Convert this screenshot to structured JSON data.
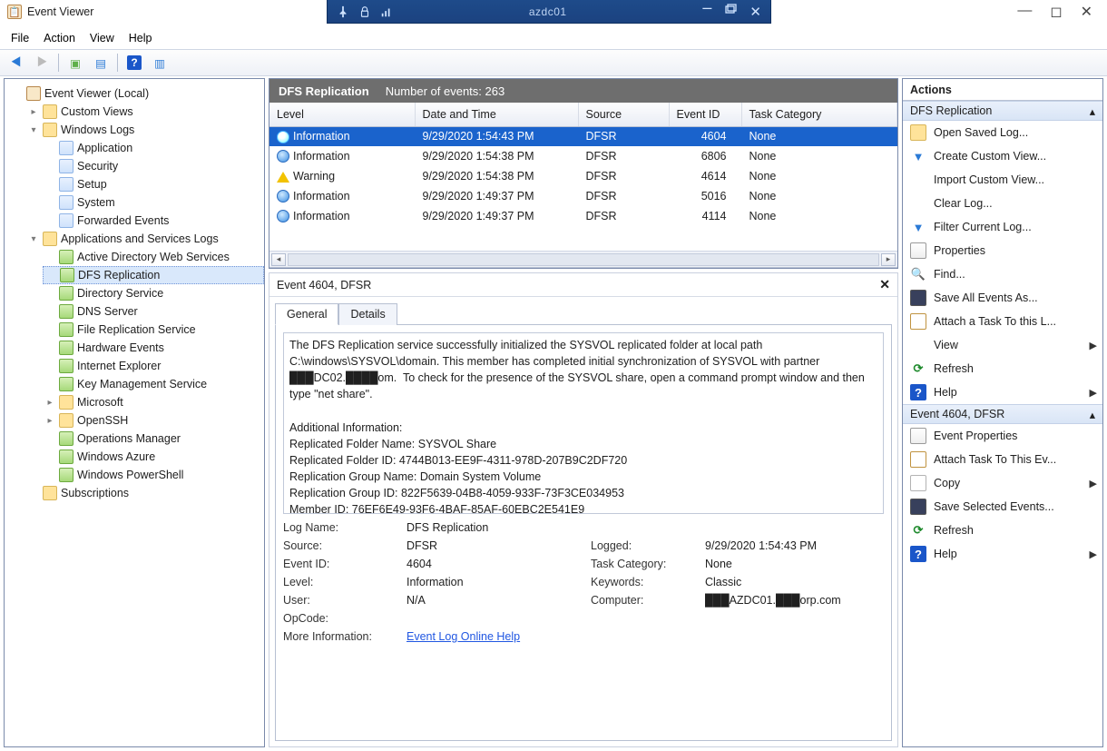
{
  "rd": {
    "host": "azdc01"
  },
  "window": {
    "title": "Event Viewer"
  },
  "menu": {
    "file": "File",
    "action": "Action",
    "view": "View",
    "help": "Help"
  },
  "tree": {
    "root": "Event Viewer (Local)",
    "custom": "Custom Views",
    "winlogs": "Windows Logs",
    "winlogs_items": [
      "Application",
      "Security",
      "Setup",
      "System",
      "Forwarded Events"
    ],
    "appsvc": "Applications and Services Logs",
    "appsvc_items": [
      "Active Directory Web Services",
      "DFS Replication",
      "Directory Service",
      "DNS Server",
      "File Replication Service",
      "Hardware Events",
      "Internet Explorer",
      "Key Management Service",
      "Microsoft",
      "OpenSSH",
      "Operations Manager",
      "Windows Azure",
      "Windows PowerShell"
    ],
    "subs": "Subscriptions"
  },
  "center": {
    "title": "DFS Replication",
    "events_count_label": "Number of events: 263",
    "columns": [
      "Level",
      "Date and Time",
      "Source",
      "Event ID",
      "Task Category"
    ],
    "rows": [
      {
        "level": "Information",
        "icon": "info",
        "datetime": "9/29/2020 1:54:43 PM",
        "source": "DFSR",
        "event_id": "4604",
        "task": "None",
        "selected": true
      },
      {
        "level": "Information",
        "icon": "info",
        "datetime": "9/29/2020 1:54:38 PM",
        "source": "DFSR",
        "event_id": "6806",
        "task": "None"
      },
      {
        "level": "Warning",
        "icon": "warn",
        "datetime": "9/29/2020 1:54:38 PM",
        "source": "DFSR",
        "event_id": "4614",
        "task": "None"
      },
      {
        "level": "Information",
        "icon": "info",
        "datetime": "9/29/2020 1:49:37 PM",
        "source": "DFSR",
        "event_id": "5016",
        "task": "None"
      },
      {
        "level": "Information",
        "icon": "info",
        "datetime": "9/29/2020 1:49:37 PM",
        "source": "DFSR",
        "event_id": "4114",
        "task": "None"
      }
    ]
  },
  "detail": {
    "header": "Event 4604, DFSR",
    "tab_general": "General",
    "tab_details": "Details",
    "message": "The DFS Replication service successfully initialized the SYSVOL replicated folder at local path C:\\windows\\SYSVOL\\domain. This member has completed initial synchronization of SYSVOL with partner ███DC02.████om.  To check for the presence of the SYSVOL share, open a command prompt window and then type \"net share\".\n\nAdditional Information:\nReplicated Folder Name: SYSVOL Share\nReplicated Folder ID: 4744B013-EE9F-4311-978D-207B9C2DF720\nReplication Group Name: Domain System Volume\nReplication Group ID: 822F5639-04B8-4059-933F-73F3CE034953\nMember ID: 76EF6E49-93F6-4BAF-85AF-60EBC2E541E9",
    "labels": {
      "log_name": "Log Name:",
      "source": "Source:",
      "event_id": "Event ID:",
      "level": "Level:",
      "user": "User:",
      "opcode": "OpCode:",
      "more_info": "More Information:",
      "logged": "Logged:",
      "task_cat": "Task Category:",
      "keywords": "Keywords:",
      "computer": "Computer:"
    },
    "values": {
      "log_name": "DFS Replication",
      "source": "DFSR",
      "event_id": "4604",
      "level": "Information",
      "user": "N/A",
      "opcode": "",
      "logged": "9/29/2020 1:54:43 PM",
      "task_cat": "None",
      "keywords": "Classic",
      "computer": "███AZDC01.███orp.com",
      "more_info_link": "Event Log Online Help"
    }
  },
  "actions": {
    "title": "Actions",
    "section1": "DFS Replication",
    "section2": "Event 4604, DFSR",
    "view_label": "View",
    "refresh_label": "Refresh",
    "help_label": "Help",
    "items1": [
      "Open Saved Log...",
      "Create Custom View...",
      "Import Custom View...",
      "Clear Log...",
      "Filter Current Log...",
      "Properties",
      "Find...",
      "Save All Events As...",
      "Attach a Task To this L..."
    ],
    "items2": [
      "Event Properties",
      "Attach Task To This Ev...",
      "Copy",
      "Save Selected Events..."
    ]
  }
}
